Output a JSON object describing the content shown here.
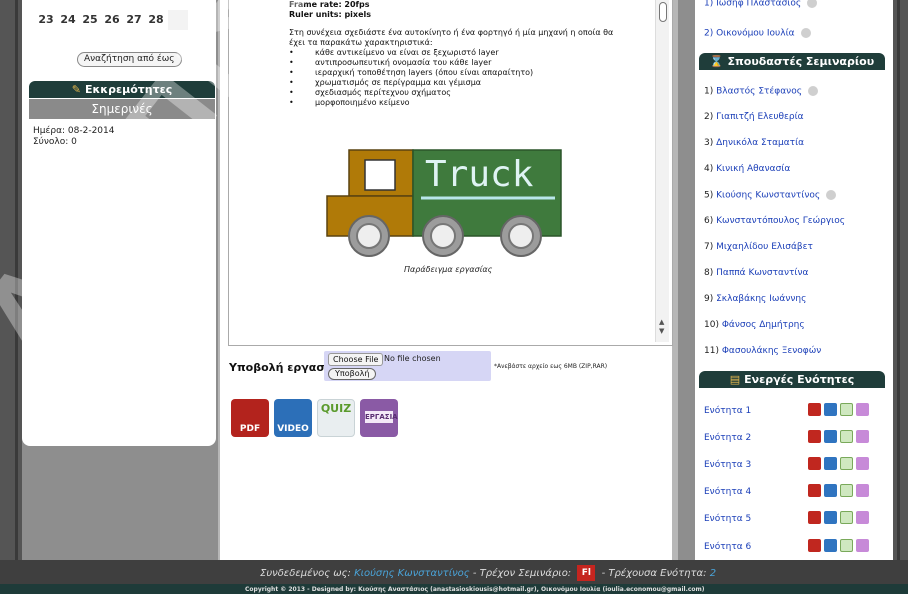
{
  "calendar": {
    "days": [
      "23",
      "24",
      "25",
      "26",
      "27",
      "28",
      ""
    ]
  },
  "left": {
    "search_button": "Αναζήτηση από έως",
    "pending_title": "Εκκρεμότητες",
    "today_title": "Σημερινές",
    "date_line": "Ημέρα:  08-2-2014",
    "total_line": "Σύνολο: 0"
  },
  "doc": {
    "frame_rate": "Frame rate: 20fps",
    "ruler_units": "Ruler units: pixels",
    "intro": "Στη συνέχεια σχεδιάστε ένα αυτοκίνητο ή ένα φορτηγό ή μία μηχανή η οποία θα έχει τα παρακάτω χαρακτηριστικά:",
    "bullets": [
      "κάθε αντικείμενο να είναι σε ξεχωριστό layer",
      "αντιπροσωπευτική ονομασία του κάθε layer",
      "ιεραρχική τοποθέτηση layers (όπου είναι απαραίτητο)",
      "χρωματισμός σε περίγραμμα και γέμισμα",
      "σχεδιασμός περίτεχνου σχήματος",
      "μορφοποιημένο κείμενο"
    ],
    "truck_text": "Truck",
    "caption": "Παράδειγμα εργασίας"
  },
  "submission": {
    "label": "Υποβολή εργασίας:",
    "choose_file": "Choose File",
    "no_file": "No file chosen",
    "upload_button": "Υποβολή",
    "note": "*Ανεβάστε αρχείο εως 6MB (ZIP,RAR)"
  },
  "big_icons": [
    {
      "name": "pdf-icon",
      "label": "PDF"
    },
    {
      "name": "video-icon",
      "label": "VIDEO"
    },
    {
      "name": "quiz-icon",
      "label": "QUIZ"
    },
    {
      "name": "task-icon",
      "label": "ΕΡΓΑΣΙΑ"
    }
  ],
  "right": {
    "top_items": [
      "1) Ιωσηφ Πλαστασιος",
      "2) Οικονόμου Ιουλία"
    ],
    "students_title": "Σπουδαστές Σεμιναρίου",
    "students": [
      {
        "num": "1)",
        "name": "Βλαστός Στέφανος"
      },
      {
        "num": "2)",
        "name": "Γιαπιτζή Ελευθερία"
      },
      {
        "num": "3)",
        "name": "Δηνικόλα Σταματία"
      },
      {
        "num": "4)",
        "name": "Κινική Αθανασία"
      },
      {
        "num": "5)",
        "name": "Κιούσης Κωνσταντίνος"
      },
      {
        "num": "6)",
        "name": "Κωνσταντόπουλος Γεώργιος"
      },
      {
        "num": "7)",
        "name": "Μιχαηλίδου Ελισάβετ"
      },
      {
        "num": "8)",
        "name": "Παππά Κωνσταντίνα"
      },
      {
        "num": "9)",
        "name": "Σκλαβάκης Ιωάννης"
      },
      {
        "num": "10)",
        "name": "Φάνσος Δημήτρης"
      },
      {
        "num": "11)",
        "name": "Φασουλάκης Ξενοφών"
      }
    ],
    "units_title": "Ενεργές Ενότητες",
    "units": [
      "Ενότητα 1",
      "Ενότητα 2",
      "Ενότητα 3",
      "Ενότητα 4",
      "Ενότητα 5",
      "Ενότητα 6"
    ]
  },
  "footer": {
    "logged_prefix": "Συνδεδεμένος ως:",
    "user": "Κιούσης Κωνσταντίνος",
    "seminar_prefix": "- Τρέχον Σεμινάριο:",
    "seminar_icon": "Fl",
    "unit_prefix": "- Τρέχουσα Ενότητα:",
    "unit_value": "2",
    "copyright": "Copyright © 2013 - Designed by: Κιούσης Αναστάσιος (anastasioskiousis@hotmail.gr), Οικονόμου Ιουλία (ioulia.economou@gmail.com)"
  },
  "watermark": "ΑΝΕΠΙΣΗΜΟ"
}
